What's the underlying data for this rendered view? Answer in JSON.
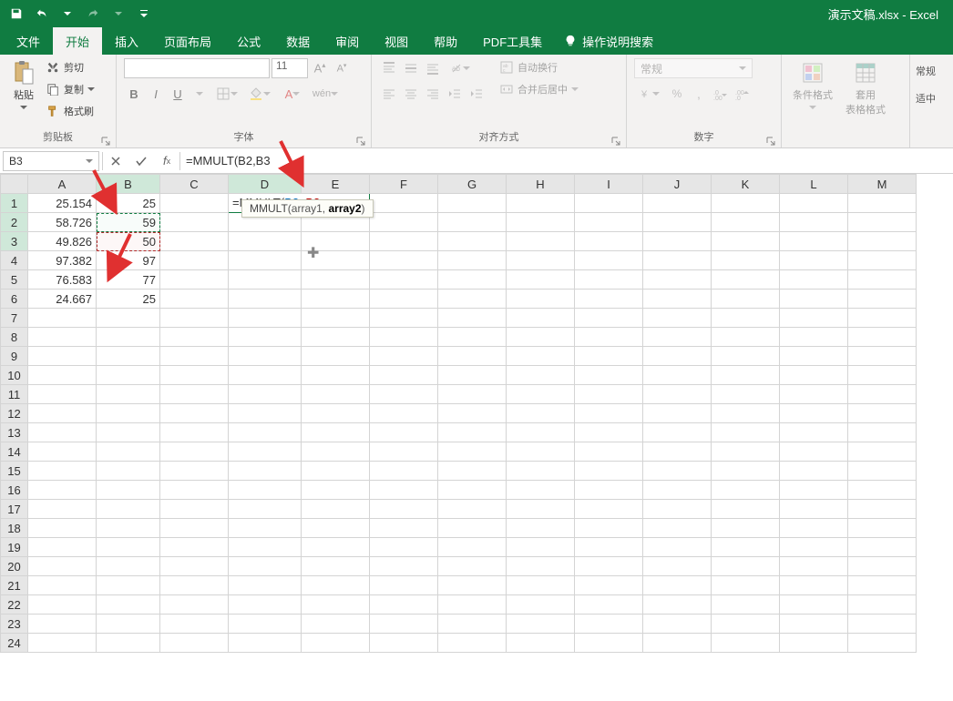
{
  "app": {
    "title": "演示文稿.xlsx - Excel"
  },
  "tabs": {
    "file": "文件",
    "home": "开始",
    "insert": "插入",
    "layout": "页面布局",
    "formula": "公式",
    "data": "数据",
    "review": "审阅",
    "view": "视图",
    "help": "帮助",
    "pdf": "PDF工具集",
    "tellme": "操作说明搜索"
  },
  "ribbon": {
    "clipboard": {
      "paste": "粘贴",
      "cut": "剪切",
      "copy": "复制",
      "format_painter": "格式刷",
      "group": "剪贴板"
    },
    "font": {
      "size": "11",
      "group": "字体"
    },
    "align": {
      "wrap": "自动换行",
      "merge": "合并后居中",
      "group": "对齐方式"
    },
    "number": {
      "format": "常规",
      "group": "数字"
    },
    "styles": {
      "cond": "条件格式",
      "table": "套用",
      "table2": "表格格式",
      "normal": "常规",
      "good": "适中"
    }
  },
  "namebox": "B3",
  "formula": "=MMULT(B2,B3",
  "tooltip": {
    "fn": "MMULT",
    "arg1": "array1",
    "arg2": "array2"
  },
  "cols": [
    "A",
    "B",
    "C",
    "D",
    "E",
    "F",
    "G",
    "H",
    "I",
    "J",
    "K",
    "L",
    "M"
  ],
  "rows": {
    "1": {
      "A": "25.154",
      "B": "25"
    },
    "2": {
      "A": "58.726",
      "B": "59"
    },
    "3": {
      "A": "49.826",
      "B": "50"
    },
    "4": {
      "A": "97.382",
      "B": "97"
    },
    "5": {
      "A": "76.583",
      "B": "77"
    },
    "6": {
      "A": "24.667",
      "B": "25"
    }
  },
  "editing_cell": {
    "prefix": "=MMULT(",
    "ref1": "B2",
    "comma": ", ",
    "ref2": "B3"
  }
}
